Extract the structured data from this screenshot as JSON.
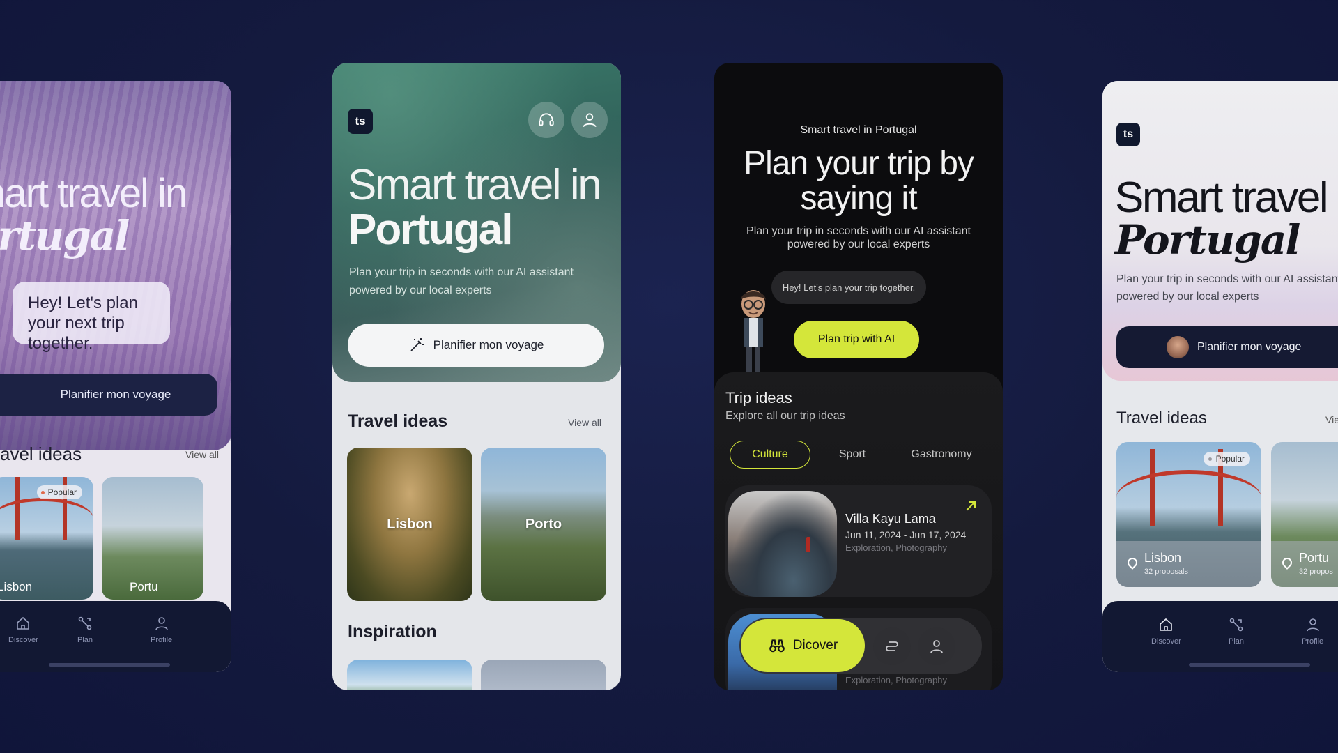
{
  "screens": {
    "left": {
      "title_line1": "mart travel in",
      "title_line2": "ortugal",
      "bubble": "Hey! Let's plan your next trip together.",
      "cta": "Planifier mon voyage",
      "section": "avel ideas",
      "view_all": "View all",
      "cards": [
        {
          "label": "Lisbon",
          "badge": "Popular"
        },
        {
          "label": "Portu"
        }
      ],
      "nav": [
        "Discover",
        "Plan",
        "Profile"
      ]
    },
    "green": {
      "logo": "ts",
      "title_line1": "Smart travel in",
      "title_line2": "Portugal",
      "subtitle": "Plan your trip in seconds with our AI assistant powered by our local experts",
      "cta": "Planifier mon voyage",
      "section": "Travel ideas",
      "view_all": "View all",
      "cards": [
        {
          "label": "Lisbon"
        },
        {
          "label": "Porto"
        }
      ],
      "section2": "Inspiration"
    },
    "dark": {
      "kicker": "Smart travel in Portugal",
      "headline": "Plan your trip by saying it",
      "subtitle": "Plan your trip in seconds with our AI assistant powered by our local experts",
      "chat": "Hey! Let's plan your trip together.",
      "ai_button": "Plan trip with AI",
      "trip_ideas_title": "Trip ideas",
      "trip_ideas_sub": "Explore all our trip ideas",
      "chips": [
        "Culture",
        "Sport",
        "Gastronomy"
      ],
      "trip": {
        "name": "Villa Kayu Lama",
        "dates": "Jun 11, 2024 - Jun 17, 2024",
        "tags": "Exploration, Photography"
      },
      "trip2_tags": "Exploration, Photography",
      "tab_discover": "Dicover"
    },
    "right": {
      "logo": "ts",
      "title_line1": "Smart travel in",
      "title_line2": "Portugal",
      "subtitle": "Plan your trip in seconds with our AI assistant powered by our local experts",
      "cta": "Planifier mon voyage",
      "section": "Travel ideas",
      "view_all": "Vie",
      "cards": [
        {
          "label": "Lisbon",
          "proposals": "32 proposals",
          "badge": "Popular"
        },
        {
          "label": "Portu",
          "proposals": "32 propos"
        }
      ],
      "nav": [
        "Discover",
        "Plan",
        "Profile"
      ]
    }
  },
  "colors": {
    "background": "#141a3e",
    "accent_lime": "#d4e63a",
    "nav_dark": "#121833"
  }
}
